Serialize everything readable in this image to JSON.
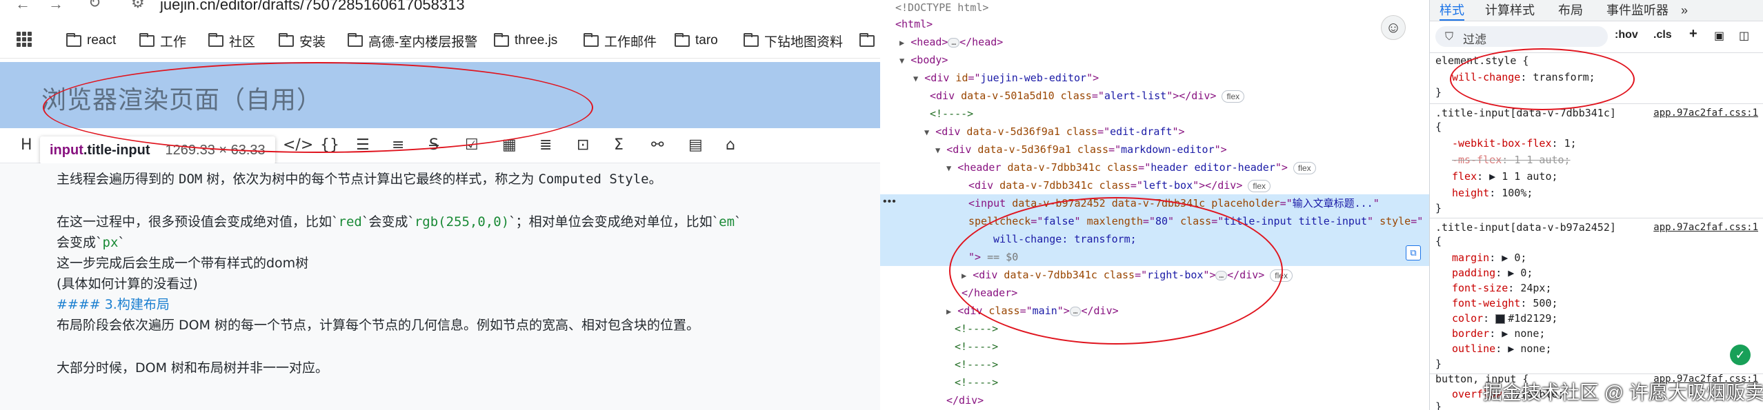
{
  "browser": {
    "url": "juejin.cn/editor/drafts/7507285160617058313",
    "nav_icons": [
      "back-icon",
      "forward-icon",
      "reload-icon",
      "site-info-icon"
    ],
    "bookmarks": [
      "react",
      "工作",
      "社区",
      "安装",
      "高德-室内楼层报警",
      "three.js",
      "工作邮件",
      "taro",
      "下钻地图资料"
    ]
  },
  "editor": {
    "title": "浏览器渲染页面（自用）",
    "toolbar_icons": [
      "heading-icon",
      "link-icon",
      "code-icon",
      "code-block-icon",
      "bulleted-list-icon",
      "numbered-list-icon",
      "strikethrough-icon",
      "task-list-icon",
      "table-icon",
      "align-icon",
      "image-icon",
      "formula-icon",
      "diagram-icon",
      "grid-icon",
      "lock-icon"
    ],
    "toolbar_first_label": "H",
    "inspect_tooltip": {
      "tag": "input",
      "class": ".title-input",
      "size": "1269.33 × 63.33"
    },
    "lines": {
      "l1a": "主线程会遍历得到的 ",
      "l1b": "DOM",
      "l1c": " 树，依次为树中的每个节点计算出它最终的样式，称之为 ",
      "l1d": "Computed Style",
      "l1e": "。",
      "l2a": "在这一过程中，很多预设值会变成绝对值，比如`",
      "l2b": "red",
      "l2c": "`会变成`",
      "l2d": "rgb(255,0,0)",
      "l2e": "`；相对单位会变成绝对单位，比如`",
      "l2f": "em",
      "l2g": "`",
      "l3a": "会变成`",
      "l3b": "px",
      "l3c": "`",
      "l4": "这一步完成后会生成一个带有样式的dom树",
      "l5": "(具体如何计算的没看过)",
      "l6": "#### 3.构建布局",
      "l7": "布局阶段会依次遍历 DOM 树的每一个节点，计算每个节点的几何信息。例如节点的宽高、相对包含块的位置。",
      "l8": "大部分时候，DOM 树和布局树并非一一对应。"
    }
  },
  "devtools": {
    "tree": {
      "doctype": "<!DOCTYPE html>",
      "html": "<html>",
      "head_open": "<head>",
      "head_close": "</head>",
      "body": "<body>",
      "div_id": "juejin-web-editor",
      "alert_attr": "data-v-501a5d10",
      "alert_class": "alert-list",
      "comment": "<!---->",
      "draft_attr": "data-v-5d36f9a1",
      "draft_class": "edit-draft",
      "md_attr": "data-v-5d36f9a1",
      "md_class": "markdown-editor",
      "header_attr": "data-v-7dbb341c",
      "header_class": "header editor-header",
      "left_class": "left-box",
      "input_attr1": "data-v-b97a2452",
      "input_attr2": "data-v-7dbb341c",
      "input_placeholder": "输入文章标题...",
      "input_spellcheck": "false",
      "input_maxlength": "80",
      "input_class": "title-input title-input",
      "input_style_val": "will-change: transform;",
      "eq0": "== $0",
      "right_class": "right-box",
      "header_close": "</header>",
      "main_class": "main",
      "div_close": "</div>",
      "badge_flex": "flex"
    },
    "styles": {
      "tabs": [
        "样式",
        "计算样式",
        "布局",
        "事件监听器"
      ],
      "filter_placeholder": "过滤",
      "hov": ":hov",
      "cls": ".cls",
      "element_style_selector": "element.style {",
      "element_style_prop": "will-change",
      "element_style_val": "transform;",
      "rule1_selector": ".title-input[data-v-7dbb341c]",
      "rule1_src": "app.97ac2faf.css:1",
      "rule1": [
        {
          "prop": "-webkit-box-flex",
          "val": "1;",
          "struck": false
        },
        {
          "prop": "-ms-flex",
          "val": "1 1 auto;",
          "struck": true
        },
        {
          "prop": "flex",
          "val": "1 1 auto;",
          "struck": false
        },
        {
          "prop": "height",
          "val": "100%;",
          "struck": false
        }
      ],
      "rule2_selector": ".title-input[data-v-b97a2452]",
      "rule2_src": "app.97ac2faf.css:1",
      "rule2": [
        {
          "prop": "margin",
          "val": "0;"
        },
        {
          "prop": "padding",
          "val": "0;"
        },
        {
          "prop": "font-size",
          "val": "24px;"
        },
        {
          "prop": "font-weight",
          "val": "500;"
        },
        {
          "prop": "color",
          "val": "#1d2129;"
        },
        {
          "prop": "border",
          "val": "none;"
        },
        {
          "prop": "outline",
          "val": "none;"
        }
      ],
      "rule3_selector": "button, input {",
      "rule3_src": "app.97ac2faf.css:1",
      "rule3_prop": "overflow",
      "rule3_val": "visible;",
      "open_brace": "{",
      "close_brace": "}"
    },
    "watermark": "掘金技术社区 @ 许愿大吸烟贩卖部",
    "accent": "#1a73e8"
  }
}
